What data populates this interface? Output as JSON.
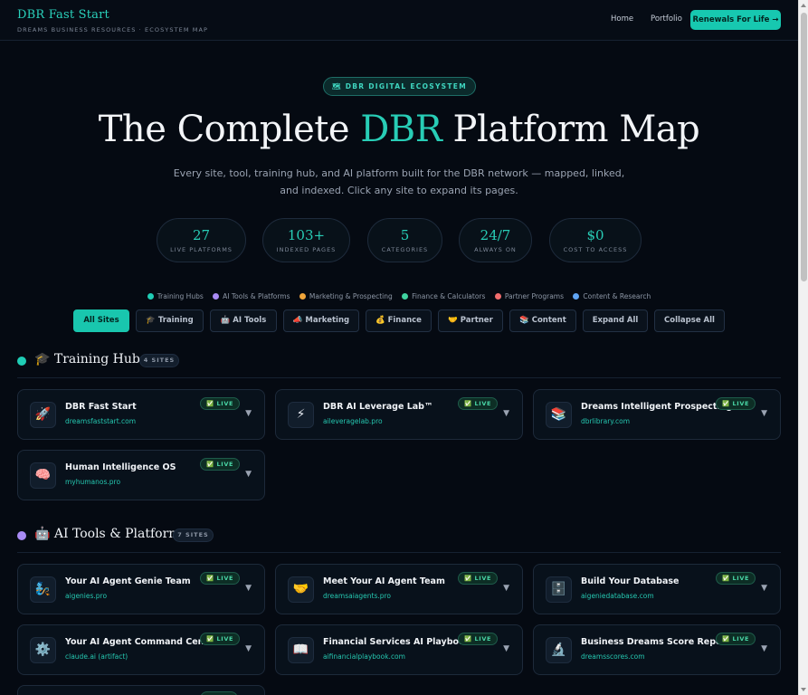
{
  "header": {
    "brand_title": "DBR Fast Start",
    "brand_subtitle": "DREAMS BUSINESS RESOURCES · ECOSYSTEM MAP",
    "nav": [
      "Home",
      "Portfolio"
    ],
    "cta_label": "Renewals For Life →"
  },
  "hero": {
    "pill_label": "🗺 DBR DIGITAL ECOSYSTEM",
    "title_pre": "The Complete ",
    "title_accent": "DBR",
    "title_post": " Platform Map",
    "description": "Every site, tool, training hub, and AI platform built for the DBR network — mapped, linked, and indexed. Click any site to expand its pages."
  },
  "stats": [
    {
      "value": "27",
      "label": "LIVE PLATFORMS"
    },
    {
      "value": "103+",
      "label": "INDEXED PAGES"
    },
    {
      "value": "5",
      "label": "CATEGORIES"
    },
    {
      "value": "24/7",
      "label": "ALWAYS ON"
    },
    {
      "value": "$0",
      "label": "COST TO ACCESS"
    }
  ],
  "legend": [
    {
      "label": "Training Hubs",
      "color": "#1fcdb5"
    },
    {
      "label": "AI Tools & Platforms",
      "color": "#a98bf5"
    },
    {
      "label": "Marketing & Prospecting",
      "color": "#f0a53a"
    },
    {
      "label": "Finance & Calculators",
      "color": "#3fd3a0"
    },
    {
      "label": "Partner Programs",
      "color": "#f26d6d"
    },
    {
      "label": "Content & Research",
      "color": "#5fa4f5"
    }
  ],
  "filters": [
    {
      "label": "All Sites",
      "active": true
    },
    {
      "label": "🎓 Training"
    },
    {
      "label": "🤖 AI Tools"
    },
    {
      "label": "📣 Marketing"
    },
    {
      "label": "💰 Finance"
    },
    {
      "label": "🤝 Partner"
    },
    {
      "label": "📚 Content"
    },
    {
      "label": "Expand All"
    },
    {
      "label": "Collapse All"
    }
  ],
  "sections": [
    {
      "title": "🎓 Training Hubs",
      "count": "4 SITES",
      "color": "#1fcdb5",
      "cards": [
        {
          "icon": "🚀",
          "icon_name": "rocket-icon",
          "name": "DBR Fast Start",
          "url": "dreamsfaststart.com",
          "badge": "✅ LIVE"
        },
        {
          "icon": "⚡",
          "icon_name": "lightning-icon",
          "name": "DBR AI Leverage Lab™",
          "url": "aileveragelab.pro",
          "badge": "✅ LIVE"
        },
        {
          "icon": "📚",
          "icon_name": "books-icon",
          "name": "Dreams Intelligent Prospecting Playbook",
          "url": "dbrlibrary.com",
          "badge": "✅ LIVE"
        },
        {
          "icon": "🧠",
          "icon_name": "brain-icon",
          "name": "Human Intelligence OS",
          "url": "myhumanos.pro",
          "badge": "✅ LIVE"
        }
      ]
    },
    {
      "title": "🤖 AI Tools & Platforms",
      "count": "7 SITES",
      "color": "#a98bf5",
      "cards": [
        {
          "icon": "🧞",
          "icon_name": "genie-icon",
          "name": "Your AI Agent Genie Team",
          "url": "aigenies.pro",
          "badge": "✅ LIVE"
        },
        {
          "icon": "🤝",
          "icon_name": "handshake-icon",
          "name": "Meet Your AI Agent Team",
          "url": "dreamsaiagents.pro",
          "badge": "✅ LIVE"
        },
        {
          "icon": "🗄️",
          "icon_name": "cabinet-icon",
          "name": "Build Your Database",
          "url": "aigeniedatabase.com",
          "badge": "✅ LIVE"
        },
        {
          "icon": "⚙️",
          "icon_name": "gear-icon",
          "name": "Your AI Agent Command Center",
          "url": "claude.ai (artifact)",
          "badge": "✅ LIVE"
        },
        {
          "icon": "📖",
          "icon_name": "book-icon",
          "name": "Financial Services AI Playbook",
          "url": "aifinancialplaybook.com",
          "badge": "✅ LIVE"
        },
        {
          "icon": "🔬",
          "icon_name": "microscope-icon",
          "name": "Business Dreams Score Report",
          "url": "dreamsscores.com",
          "badge": "✅ LIVE"
        }
      ]
    }
  ]
}
